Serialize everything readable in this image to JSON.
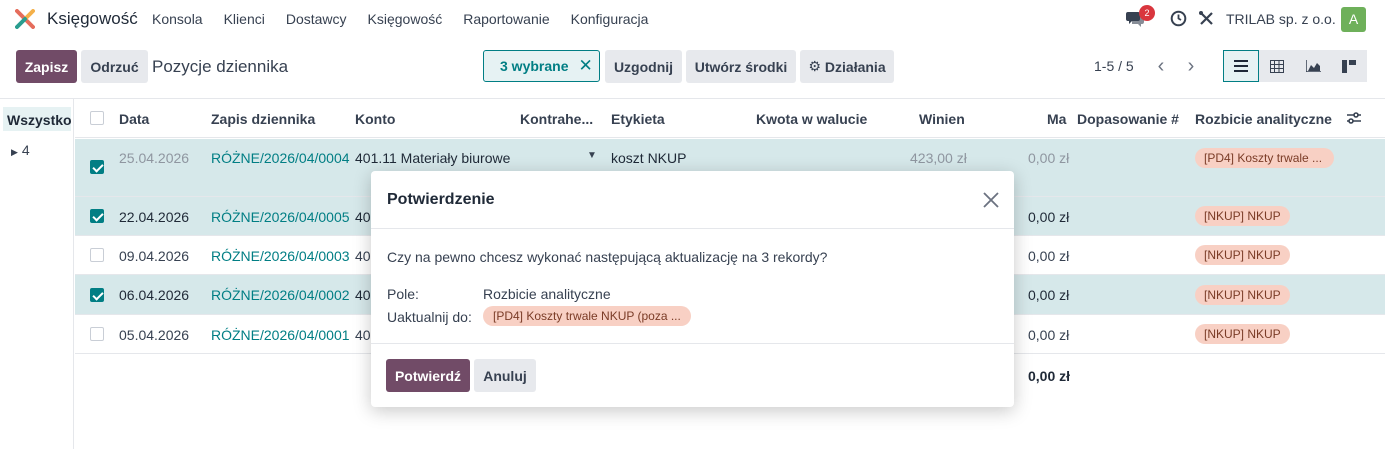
{
  "nav": {
    "app_name": "Księgowość",
    "menu": [
      "Konsola",
      "Klienci",
      "Dostawcy",
      "Księgowość",
      "Raportowanie",
      "Konfiguracja"
    ],
    "chat_badge": "2",
    "company": "TRILAB sp. z o.o.",
    "avatar": "A"
  },
  "control": {
    "save": "Zapisz",
    "discard": "Odrzuć",
    "title": "Pozycje dziennika",
    "selected": "3 wybrane",
    "reconcile": "Uzgodnij",
    "create_assets": "Utwórz środki",
    "actions": "Działania",
    "pager": "1-5 / 5"
  },
  "side": {
    "all": "Wszystko",
    "group": "4"
  },
  "table": {
    "headers": {
      "date": "Data",
      "entry": "Zapis dziennika",
      "account": "Konto",
      "partner": "Kontrahe...",
      "label": "Etykieta",
      "amount_currency": "Kwota w walucie",
      "debit": "Winien",
      "credit": "Ma",
      "matching": "Dopasowanie #",
      "analytic": "Rozbicie analityczne"
    },
    "rows": [
      {
        "date": "25.04.2026",
        "entry": "RÓŻNE/2026/04/0004",
        "account": "401.11 Materiały biurowe",
        "label": "koszt NKUP",
        "debit": "423,00 zł",
        "credit": "0,00 zł",
        "analytic": "[PD4] Koszty trwale ..."
      },
      {
        "date": "22.04.2026",
        "entry": "RÓŻNE/2026/04/0005",
        "account": "40",
        "credit": "0,00 zł",
        "analytic": "[NKUP] NKUP"
      },
      {
        "date": "09.04.2026",
        "entry": "RÓŻNE/2026/04/0003",
        "account": "40",
        "credit": "0,00 zł",
        "analytic": "[NKUP] NKUP"
      },
      {
        "date": "06.04.2026",
        "entry": "RÓŻNE/2026/04/0002",
        "account": "40",
        "credit": "0,00 zł",
        "analytic": "[NKUP] NKUP"
      },
      {
        "date": "05.04.2026",
        "entry": "RÓŻNE/2026/04/0001",
        "account": "40",
        "credit": "0,00 zł",
        "analytic": "[NKUP] NKUP"
      }
    ],
    "total_credit": "0,00 zł"
  },
  "modal": {
    "title": "Potwierdzenie",
    "question": "Czy na pewno chcesz wykonać następującą aktualizację na 3 rekordy?",
    "field_label": "Pole:",
    "field_value": "Rozbicie analityczne",
    "update_label": "Uaktualnij do:",
    "update_value": "[PD4] Koszty trwale NKUP (poza ...",
    "confirm": "Potwierdź",
    "cancel": "Anuluj"
  },
  "colors": {
    "primary": "#714b67",
    "teal": "#017e84",
    "tag": "#f8d0c4",
    "selected_row": "#d6e8ea"
  }
}
